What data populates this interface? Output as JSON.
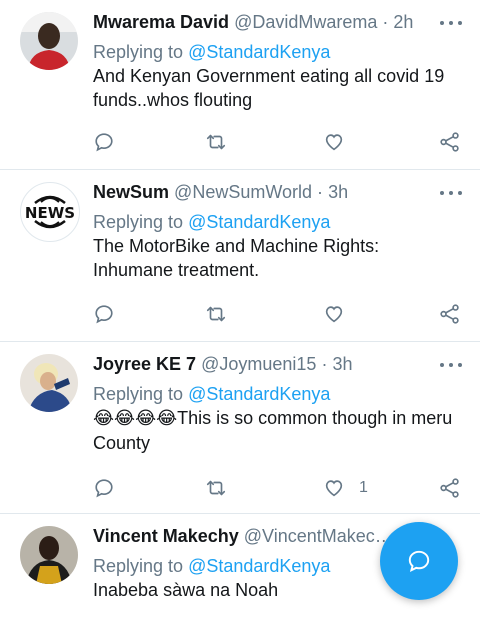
{
  "replying_label": "Replying to",
  "tweets": [
    {
      "name": "Mwarema David",
      "handle": "@DavidMwarema",
      "sep": "·",
      "time": "2h",
      "reply_to": "@StandardKenya",
      "text": "And Kenyan Government eating all covid 19 funds..whos flouting",
      "likes": ""
    },
    {
      "name": "NewSum",
      "handle": "@NewSumWorld",
      "sep": "·",
      "time": "3h",
      "reply_to": "@StandardKenya",
      "text": "The MotorBike and Machine Rights: Inhumane treatment.",
      "avatar_text": "NEWS",
      "likes": ""
    },
    {
      "name": "Joyree KE 7",
      "handle": "@Joymueni15",
      "sep": "·",
      "time": "3h",
      "reply_to": "@StandardKenya",
      "text_emoji": "😂😂😂😂",
      "text": "This is so common though in meru County",
      "likes": "1"
    },
    {
      "name": "Vincent Makechy",
      "handle": "@VincentMakec…",
      "reply_to": "@StandardKenya",
      "text": "Inabeba sàwa na Noah"
    }
  ],
  "icons": {
    "reply": "reply-icon",
    "retweet": "retweet-icon",
    "like": "heart-icon",
    "share": "share-icon",
    "more": "more-icon",
    "compose": "compose-reply-icon"
  },
  "colors": {
    "accent": "#1da1f2",
    "muted": "#657786",
    "text": "#14171a",
    "divider": "#e1e8ed"
  }
}
